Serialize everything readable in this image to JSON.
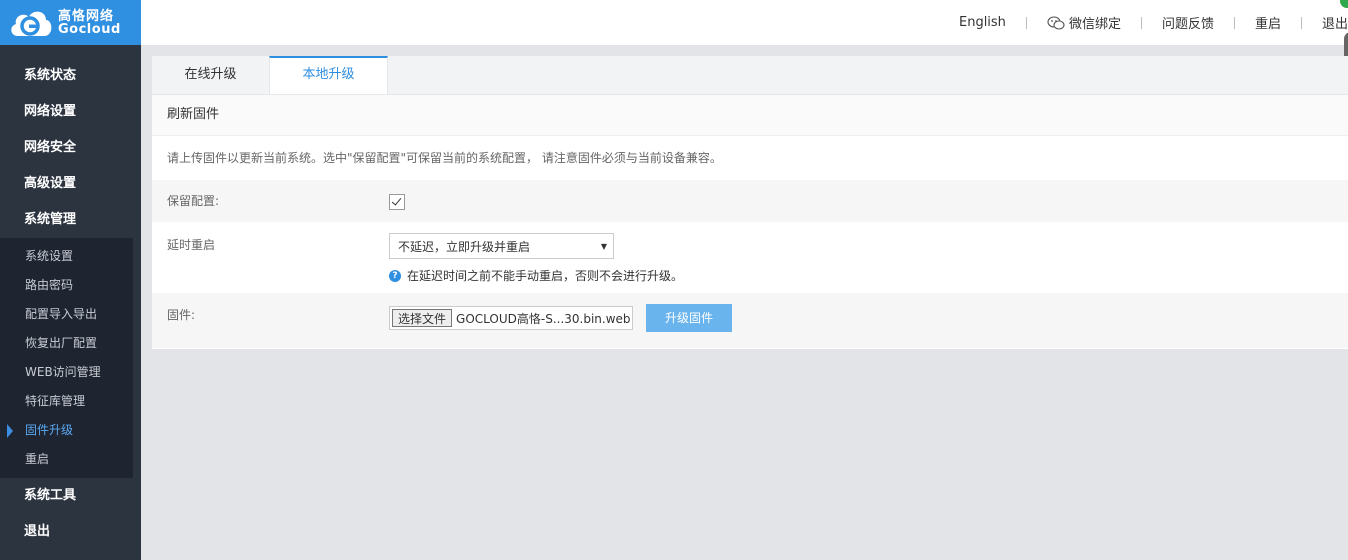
{
  "brand": {
    "cn": "高恪网络",
    "en": "Gocloud"
  },
  "topnav": {
    "english": "English",
    "wechat": "微信绑定",
    "feedback": "问题反馈",
    "restart": "重启",
    "logout": "退出"
  },
  "sidebar": {
    "main_top": [
      "系统状态",
      "网络设置",
      "网络安全",
      "高级设置",
      "系统管理"
    ],
    "sub_items": [
      "系统设置",
      "路由密码",
      "配置导入导出",
      "恢复出厂配置",
      "WEB访问管理",
      "特征库管理",
      "固件升级",
      "重启"
    ],
    "active_sub": "固件升级",
    "main_bottom": [
      "系统工具",
      "退出"
    ]
  },
  "tabs": [
    "在线升级",
    "本地升级"
  ],
  "active_tab": "本地升级",
  "section_title": "刷新固件",
  "description": "请上传固件以更新当前系统。选中\"保留配置\"可保留当前的系统配置， 请注意固件必须与当前设备兼容。",
  "form": {
    "keep_config_label": "保留配置:",
    "keep_config_checked": true,
    "delay_label": "延时重启",
    "delay_value": "不延迟，立即升级并重启",
    "delay_hint": "在延迟时间之前不能手动重启，否则不会进行升级。",
    "firmware_label": "固件:",
    "choose_file_label": "选择文件",
    "file_name": "GOCLOUD高恪-S...30.bin.web",
    "upgrade_button": "升级固件"
  },
  "colors": {
    "accent": "#2f8fe0",
    "sidebar": "#2c3440",
    "button": "#6ab4ee"
  }
}
